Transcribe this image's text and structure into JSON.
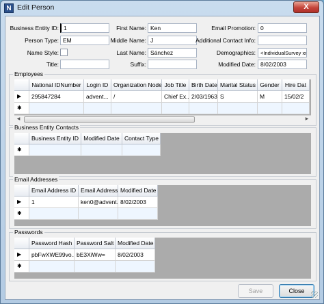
{
  "window": {
    "title": "Edit Person",
    "app_icon_letter": "N",
    "close_glyph": "X"
  },
  "form": {
    "business_entity_id": {
      "label": "Business Entity ID:",
      "value": "1"
    },
    "person_type": {
      "label": "Person Type:",
      "value": "EM"
    },
    "name_style": {
      "label": "Name Style:",
      "checked": false
    },
    "title": {
      "label": "Title:",
      "value": ""
    },
    "first_name": {
      "label": "First Name:",
      "value": "Ken"
    },
    "middle_name": {
      "label": "Middle Name:",
      "value": "J"
    },
    "last_name": {
      "label": "Last Name:",
      "value": "Sánchez"
    },
    "suffix": {
      "label": "Suffix:",
      "value": ""
    },
    "email_promotion": {
      "label": "Email Promotion:",
      "value": "0"
    },
    "additional_contact_info": {
      "label": "Additional Contact Info:",
      "value": ""
    },
    "demographics": {
      "label": "Demographics:",
      "value": "<IndividualSurvey xr"
    },
    "modified_date": {
      "label": "Modified Date:",
      "value": "8/02/2003"
    }
  },
  "employees": {
    "title": "Employees",
    "columns": [
      "National IDNumber",
      "Login ID",
      "Organization Node",
      "Job Title",
      "Birth Date",
      "Marital Status",
      "Gender",
      "Hire Dat"
    ],
    "rows": [
      [
        "295847284",
        "advent...",
        "/",
        "Chief Ex...",
        "2/03/1963",
        "S",
        "M",
        "15/02/2"
      ]
    ],
    "row_marker": "▶",
    "new_marker": "✱",
    "scroll_left": "◀",
    "scroll_right": "▶"
  },
  "contacts": {
    "title": "Business Entity Contacts",
    "columns": [
      "Business Entity ID",
      "Modified Date",
      "Contact Type"
    ],
    "rows": [],
    "new_marker": "✱"
  },
  "emails": {
    "title": "Email Addresses",
    "columns": [
      "Email Address ID",
      "Email Address",
      "Modified Date"
    ],
    "rows": [
      [
        "1",
        "ken0@advent...",
        "8/02/2003"
      ]
    ],
    "row_marker": "▶",
    "new_marker": "✱"
  },
  "passwords": {
    "title": "Passwords",
    "columns": [
      "Password Hash",
      "Password Salt",
      "Modified Date"
    ],
    "rows": [
      [
        "pbFwXWE99vo...",
        "bE3XiWw=",
        "8/02/2003"
      ]
    ],
    "row_marker": "▶",
    "new_marker": "✱"
  },
  "buttons": {
    "save": "Save",
    "close": "Close"
  }
}
